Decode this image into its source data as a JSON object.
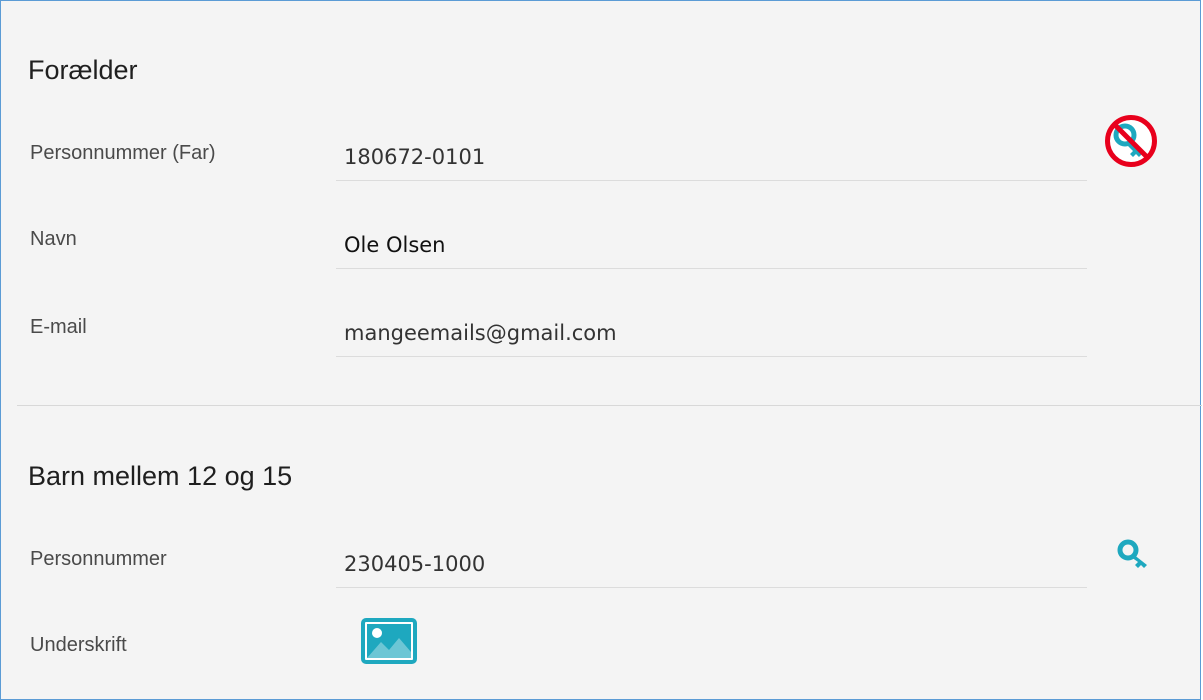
{
  "parent_section": {
    "title": "Forælder",
    "fields": [
      {
        "label": "Personnummer (Far)",
        "value": "180672-0101"
      },
      {
        "label": "Navn",
        "value": "Ole Olsen"
      },
      {
        "label": "E-mail",
        "value": "mangeemails@gmail.com"
      }
    ],
    "icons": {
      "key_disabled": "no-key-icon"
    }
  },
  "child_section": {
    "title": "Barn mellem 12 og 15",
    "fields": [
      {
        "label": "Personnummer",
        "value": "230405-1000"
      },
      {
        "label": "Underskrift"
      }
    ],
    "icons": {
      "key": "key-icon",
      "signature": "image-icon"
    }
  },
  "colors": {
    "panel_border": "#5b9bd5",
    "icon_teal": "#1ea8bf",
    "prohibited_red": "#e8001c"
  }
}
